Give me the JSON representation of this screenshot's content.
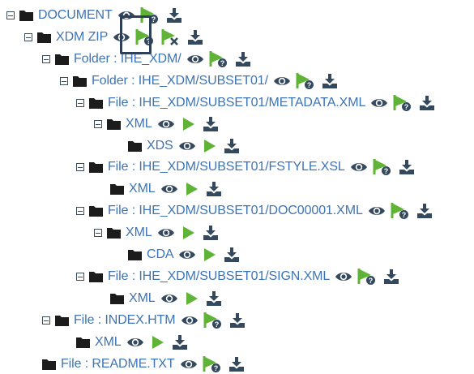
{
  "colors": {
    "link": "#3d74b6",
    "icon_dark": "#34495e",
    "play_green": "#5fb336",
    "flag_green": "#5fb336",
    "highlight_border": "#2e3f58"
  },
  "tree": [
    {
      "label": "DOCUMENT",
      "toggle": true,
      "actions": [
        "eye-icon",
        "validate-flag-icon",
        "download-icon"
      ]
    },
    {
      "label": "XDM ZIP",
      "toggle": true,
      "actions": [
        "eye-icon",
        "validate-flag-icon",
        "validate-error-flag-icon",
        "download-icon"
      ]
    },
    {
      "label": "Folder : IHE_XDM/",
      "toggle": true,
      "actions": [
        "eye-icon",
        "validate-flag-icon",
        "download-icon"
      ]
    },
    {
      "label": "Folder : IHE_XDM/SUBSET01/",
      "toggle": true,
      "actions": [
        "eye-icon",
        "validate-flag-icon",
        "download-icon"
      ]
    },
    {
      "label": "File : IHE_XDM/SUBSET01/METADATA.XML",
      "toggle": true,
      "actions": [
        "eye-icon",
        "validate-flag-icon",
        "download-icon"
      ]
    },
    {
      "label": "XML",
      "toggle": true,
      "actions": [
        "eye-icon",
        "play-icon",
        "download-icon"
      ]
    },
    {
      "label": "XDS",
      "toggle": false,
      "actions": [
        "eye-icon",
        "play-icon",
        "download-icon"
      ]
    },
    {
      "label": "File : IHE_XDM/SUBSET01/FSTYLE.XSL",
      "toggle": true,
      "actions": [
        "eye-icon",
        "validate-flag-icon",
        "download-icon"
      ]
    },
    {
      "label": "XML",
      "toggle": false,
      "actions": [
        "eye-icon",
        "play-icon",
        "download-icon"
      ]
    },
    {
      "label": "File : IHE_XDM/SUBSET01/DOC00001.XML",
      "toggle": true,
      "actions": [
        "eye-icon",
        "validate-flag-icon",
        "download-icon"
      ]
    },
    {
      "label": "XML",
      "toggle": true,
      "actions": [
        "eye-icon",
        "play-icon",
        "download-icon"
      ]
    },
    {
      "label": "CDA",
      "toggle": false,
      "actions": [
        "eye-icon",
        "play-icon",
        "download-icon"
      ]
    },
    {
      "label": "File : IHE_XDM/SUBSET01/SIGN.XML",
      "toggle": true,
      "actions": [
        "eye-icon",
        "validate-flag-icon",
        "download-icon"
      ]
    },
    {
      "label": "XML",
      "toggle": false,
      "actions": [
        "eye-icon",
        "play-icon",
        "download-icon"
      ]
    },
    {
      "label": "File : INDEX.HTM",
      "toggle": true,
      "actions": [
        "eye-icon",
        "validate-flag-icon",
        "download-icon"
      ]
    },
    {
      "label": "XML",
      "toggle": false,
      "actions": [
        "eye-icon",
        "play-icon",
        "download-icon"
      ]
    },
    {
      "label": "File : README.TXT",
      "toggle": false,
      "actions": [
        "eye-icon",
        "validate-flag-icon",
        "download-icon"
      ]
    }
  ]
}
